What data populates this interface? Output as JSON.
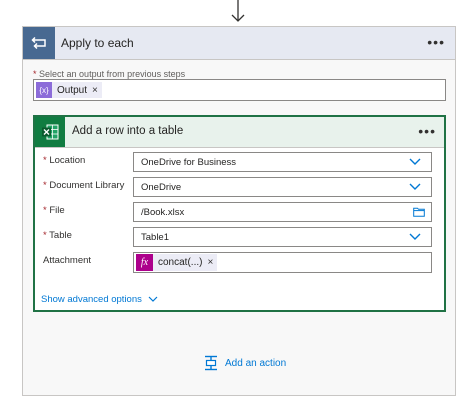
{
  "loop": {
    "title": "Apply to each",
    "more_label": "•••",
    "select_label": "Select an output from previous steps",
    "required_mark": "*",
    "token": {
      "icon_text": "{x}",
      "label": "Output",
      "remove": "×",
      "color": "#8c6cd9"
    }
  },
  "action": {
    "title": "Add a row into a table",
    "more_label": "•••",
    "fields": [
      {
        "label": "Location",
        "required": true,
        "value": "OneDrive for Business",
        "control": "dropdown"
      },
      {
        "label": "Document Library",
        "required": true,
        "value": "OneDrive",
        "control": "dropdown"
      },
      {
        "label": "File",
        "required": true,
        "value": "/Book.xlsx",
        "control": "file-picker"
      },
      {
        "label": "Table",
        "required": true,
        "value": "Table1",
        "control": "dropdown"
      },
      {
        "label": "Attachment",
        "required": false,
        "value": "",
        "control": "text"
      }
    ],
    "attachment_token": {
      "icon_text": "fx",
      "label": "concat(...)",
      "remove": "×",
      "color": "#ad008c"
    },
    "advanced_label": "Show advanced options"
  },
  "add_action_label": "Add an action",
  "colors": {
    "loop_accent": "#486991",
    "excel_accent": "#107c41",
    "link": "#0078d4"
  }
}
